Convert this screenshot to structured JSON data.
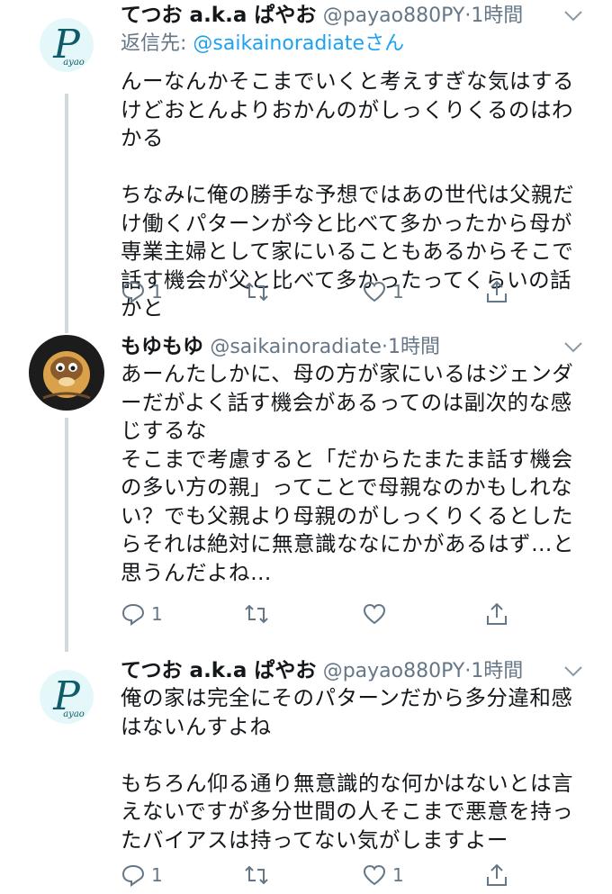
{
  "tweets": [
    {
      "name": "てつお a.k.a ぱやお",
      "handle": "@payao880PY",
      "time": "1時間",
      "reply_prefix": "返信先: ",
      "reply_handle": "@saikainoradiate",
      "reply_suffix": "さん",
      "text": "んーなんかそこまでいくと考えすぎな気はするけどおとんよりおかんのがしっくりくるのはわかる\n\nちなみに俺の勝手な予想ではあの世代は父親だけ働くパターンが今と比べて多かったから母が専業主婦として家にいることもあるからそこで話す機会が父と比べて多かったってくらいの話かと",
      "reply_count": "1",
      "retweet_count": "",
      "like_count": "1",
      "avatar_letter": "P",
      "avatar_sub": "ayao"
    },
    {
      "name": "もゆもゆ",
      "handle": "@saikainoradiate",
      "time": "1時間",
      "text": "あーんたしかに、母の方が家にいるはジェンダーだがよく話す機会があるってのは副次的な感じするな\nそこまで考慮すると「だからたまたま話す機会の多い方の親」ってことで母親なのかもしれない？でも父親より母親のがしっくりくるとしたらそれは絶対に無意識ななにかがあるはず…と思うんだよね…",
      "reply_count": "1",
      "retweet_count": "",
      "like_count": ""
    },
    {
      "name": "てつお a.k.a ぱやお",
      "handle": "@payao880PY",
      "time": "1時間",
      "text": "俺の家は完全にそのパターンだから多分違和感はないんすよね\n\nもちろん仰る通り無意識的な何かはないとは言えないですが多分世間の人そこまで悪意を持ったバイアスは持ってない気がしますよー",
      "reply_count": "1",
      "retweet_count": "",
      "like_count": "1",
      "avatar_letter": "P",
      "avatar_sub": "ayao"
    }
  ],
  "icons": [
    "reply-icon",
    "retweet-icon",
    "like-icon",
    "share-icon",
    "caret-down-icon"
  ],
  "colors": {
    "text": "#14171a",
    "muted": "#657786",
    "link": "#1da1f2",
    "thread": "#cfd9de"
  }
}
